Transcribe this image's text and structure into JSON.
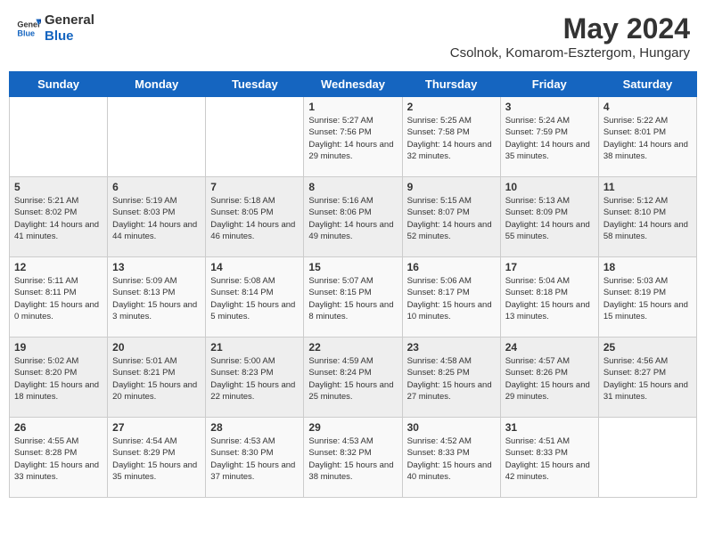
{
  "header": {
    "logo_general": "General",
    "logo_blue": "Blue",
    "title": "May 2024",
    "subtitle": "Csolnok, Komarom-Esztergom, Hungary"
  },
  "days_of_week": [
    "Sunday",
    "Monday",
    "Tuesday",
    "Wednesday",
    "Thursday",
    "Friday",
    "Saturday"
  ],
  "weeks": [
    [
      {
        "day": "",
        "info": ""
      },
      {
        "day": "",
        "info": ""
      },
      {
        "day": "",
        "info": ""
      },
      {
        "day": "1",
        "info": "Sunrise: 5:27 AM\nSunset: 7:56 PM\nDaylight: 14 hours\nand 29 minutes."
      },
      {
        "day": "2",
        "info": "Sunrise: 5:25 AM\nSunset: 7:58 PM\nDaylight: 14 hours\nand 32 minutes."
      },
      {
        "day": "3",
        "info": "Sunrise: 5:24 AM\nSunset: 7:59 PM\nDaylight: 14 hours\nand 35 minutes."
      },
      {
        "day": "4",
        "info": "Sunrise: 5:22 AM\nSunset: 8:01 PM\nDaylight: 14 hours\nand 38 minutes."
      }
    ],
    [
      {
        "day": "5",
        "info": "Sunrise: 5:21 AM\nSunset: 8:02 PM\nDaylight: 14 hours\nand 41 minutes."
      },
      {
        "day": "6",
        "info": "Sunrise: 5:19 AM\nSunset: 8:03 PM\nDaylight: 14 hours\nand 44 minutes."
      },
      {
        "day": "7",
        "info": "Sunrise: 5:18 AM\nSunset: 8:05 PM\nDaylight: 14 hours\nand 46 minutes."
      },
      {
        "day": "8",
        "info": "Sunrise: 5:16 AM\nSunset: 8:06 PM\nDaylight: 14 hours\nand 49 minutes."
      },
      {
        "day": "9",
        "info": "Sunrise: 5:15 AM\nSunset: 8:07 PM\nDaylight: 14 hours\nand 52 minutes."
      },
      {
        "day": "10",
        "info": "Sunrise: 5:13 AM\nSunset: 8:09 PM\nDaylight: 14 hours\nand 55 minutes."
      },
      {
        "day": "11",
        "info": "Sunrise: 5:12 AM\nSunset: 8:10 PM\nDaylight: 14 hours\nand 58 minutes."
      }
    ],
    [
      {
        "day": "12",
        "info": "Sunrise: 5:11 AM\nSunset: 8:11 PM\nDaylight: 15 hours\nand 0 minutes."
      },
      {
        "day": "13",
        "info": "Sunrise: 5:09 AM\nSunset: 8:13 PM\nDaylight: 15 hours\nand 3 minutes."
      },
      {
        "day": "14",
        "info": "Sunrise: 5:08 AM\nSunset: 8:14 PM\nDaylight: 15 hours\nand 5 minutes."
      },
      {
        "day": "15",
        "info": "Sunrise: 5:07 AM\nSunset: 8:15 PM\nDaylight: 15 hours\nand 8 minutes."
      },
      {
        "day": "16",
        "info": "Sunrise: 5:06 AM\nSunset: 8:17 PM\nDaylight: 15 hours\nand 10 minutes."
      },
      {
        "day": "17",
        "info": "Sunrise: 5:04 AM\nSunset: 8:18 PM\nDaylight: 15 hours\nand 13 minutes."
      },
      {
        "day": "18",
        "info": "Sunrise: 5:03 AM\nSunset: 8:19 PM\nDaylight: 15 hours\nand 15 minutes."
      }
    ],
    [
      {
        "day": "19",
        "info": "Sunrise: 5:02 AM\nSunset: 8:20 PM\nDaylight: 15 hours\nand 18 minutes."
      },
      {
        "day": "20",
        "info": "Sunrise: 5:01 AM\nSunset: 8:21 PM\nDaylight: 15 hours\nand 20 minutes."
      },
      {
        "day": "21",
        "info": "Sunrise: 5:00 AM\nSunset: 8:23 PM\nDaylight: 15 hours\nand 22 minutes."
      },
      {
        "day": "22",
        "info": "Sunrise: 4:59 AM\nSunset: 8:24 PM\nDaylight: 15 hours\nand 25 minutes."
      },
      {
        "day": "23",
        "info": "Sunrise: 4:58 AM\nSunset: 8:25 PM\nDaylight: 15 hours\nand 27 minutes."
      },
      {
        "day": "24",
        "info": "Sunrise: 4:57 AM\nSunset: 8:26 PM\nDaylight: 15 hours\nand 29 minutes."
      },
      {
        "day": "25",
        "info": "Sunrise: 4:56 AM\nSunset: 8:27 PM\nDaylight: 15 hours\nand 31 minutes."
      }
    ],
    [
      {
        "day": "26",
        "info": "Sunrise: 4:55 AM\nSunset: 8:28 PM\nDaylight: 15 hours\nand 33 minutes."
      },
      {
        "day": "27",
        "info": "Sunrise: 4:54 AM\nSunset: 8:29 PM\nDaylight: 15 hours\nand 35 minutes."
      },
      {
        "day": "28",
        "info": "Sunrise: 4:53 AM\nSunset: 8:30 PM\nDaylight: 15 hours\nand 37 minutes."
      },
      {
        "day": "29",
        "info": "Sunrise: 4:53 AM\nSunset: 8:32 PM\nDaylight: 15 hours\nand 38 minutes."
      },
      {
        "day": "30",
        "info": "Sunrise: 4:52 AM\nSunset: 8:33 PM\nDaylight: 15 hours\nand 40 minutes."
      },
      {
        "day": "31",
        "info": "Sunrise: 4:51 AM\nSunset: 8:33 PM\nDaylight: 15 hours\nand 42 minutes."
      },
      {
        "day": "",
        "info": ""
      }
    ]
  ]
}
